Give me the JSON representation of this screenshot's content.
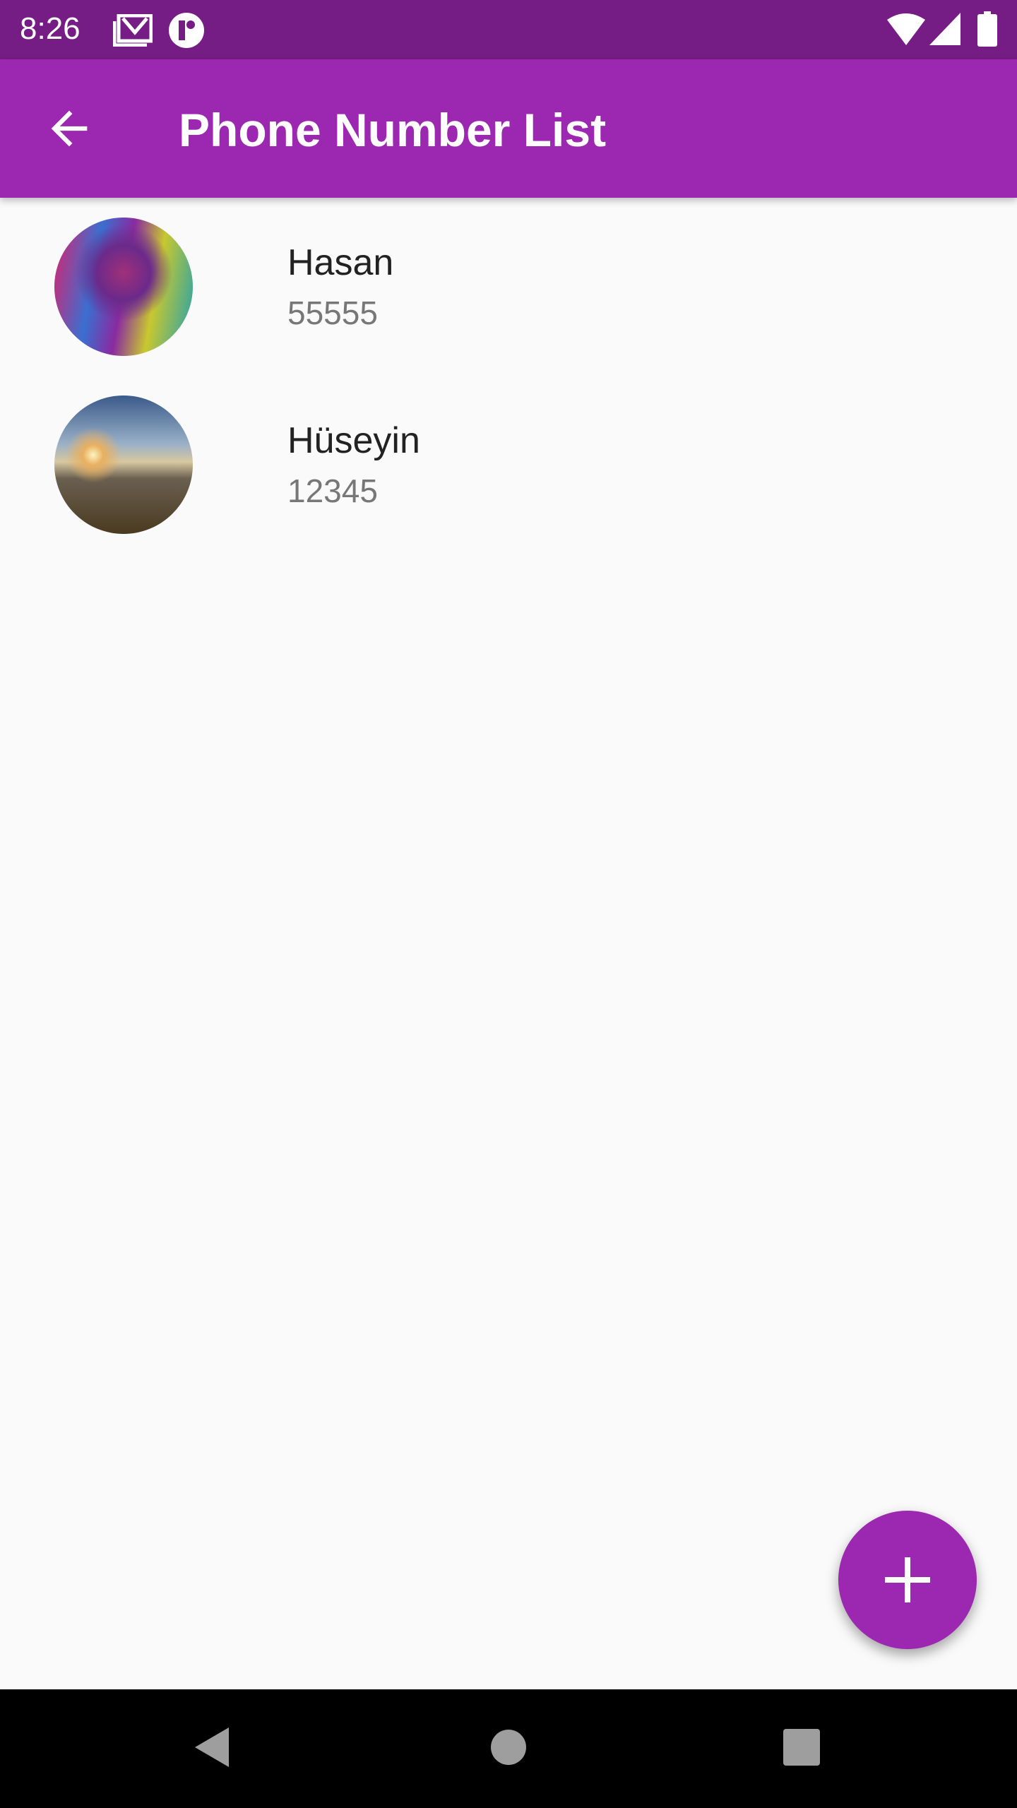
{
  "status_bar": {
    "time": "8:26",
    "icons": [
      "gmail-icon",
      "app-notification-icon",
      "wifi-icon",
      "signal-icon",
      "battery-icon"
    ]
  },
  "app_bar": {
    "title": "Phone Number List",
    "back_icon": "arrow-back-icon"
  },
  "contacts": [
    {
      "name": "Hasan",
      "number": "55555"
    },
    {
      "name": "Hüseyin",
      "number": "12345"
    }
  ],
  "fab": {
    "icon": "plus-icon"
  },
  "colors": {
    "primary": "#9c27b0",
    "primary_dark": "#751d84"
  }
}
